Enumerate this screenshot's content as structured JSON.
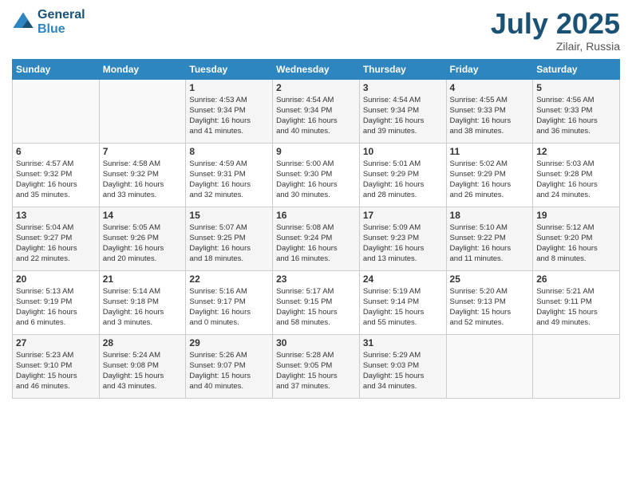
{
  "header": {
    "logo_line1": "General",
    "logo_line2": "Blue",
    "month": "July 2025",
    "location": "Zilair, Russia"
  },
  "weekdays": [
    "Sunday",
    "Monday",
    "Tuesday",
    "Wednesday",
    "Thursday",
    "Friday",
    "Saturday"
  ],
  "weeks": [
    [
      {
        "day": "",
        "info": ""
      },
      {
        "day": "",
        "info": ""
      },
      {
        "day": "1",
        "info": "Sunrise: 4:53 AM\nSunset: 9:34 PM\nDaylight: 16 hours\nand 41 minutes."
      },
      {
        "day": "2",
        "info": "Sunrise: 4:54 AM\nSunset: 9:34 PM\nDaylight: 16 hours\nand 40 minutes."
      },
      {
        "day": "3",
        "info": "Sunrise: 4:54 AM\nSunset: 9:34 PM\nDaylight: 16 hours\nand 39 minutes."
      },
      {
        "day": "4",
        "info": "Sunrise: 4:55 AM\nSunset: 9:33 PM\nDaylight: 16 hours\nand 38 minutes."
      },
      {
        "day": "5",
        "info": "Sunrise: 4:56 AM\nSunset: 9:33 PM\nDaylight: 16 hours\nand 36 minutes."
      }
    ],
    [
      {
        "day": "6",
        "info": "Sunrise: 4:57 AM\nSunset: 9:32 PM\nDaylight: 16 hours\nand 35 minutes."
      },
      {
        "day": "7",
        "info": "Sunrise: 4:58 AM\nSunset: 9:32 PM\nDaylight: 16 hours\nand 33 minutes."
      },
      {
        "day": "8",
        "info": "Sunrise: 4:59 AM\nSunset: 9:31 PM\nDaylight: 16 hours\nand 32 minutes."
      },
      {
        "day": "9",
        "info": "Sunrise: 5:00 AM\nSunset: 9:30 PM\nDaylight: 16 hours\nand 30 minutes."
      },
      {
        "day": "10",
        "info": "Sunrise: 5:01 AM\nSunset: 9:29 PM\nDaylight: 16 hours\nand 28 minutes."
      },
      {
        "day": "11",
        "info": "Sunrise: 5:02 AM\nSunset: 9:29 PM\nDaylight: 16 hours\nand 26 minutes."
      },
      {
        "day": "12",
        "info": "Sunrise: 5:03 AM\nSunset: 9:28 PM\nDaylight: 16 hours\nand 24 minutes."
      }
    ],
    [
      {
        "day": "13",
        "info": "Sunrise: 5:04 AM\nSunset: 9:27 PM\nDaylight: 16 hours\nand 22 minutes."
      },
      {
        "day": "14",
        "info": "Sunrise: 5:05 AM\nSunset: 9:26 PM\nDaylight: 16 hours\nand 20 minutes."
      },
      {
        "day": "15",
        "info": "Sunrise: 5:07 AM\nSunset: 9:25 PM\nDaylight: 16 hours\nand 18 minutes."
      },
      {
        "day": "16",
        "info": "Sunrise: 5:08 AM\nSunset: 9:24 PM\nDaylight: 16 hours\nand 16 minutes."
      },
      {
        "day": "17",
        "info": "Sunrise: 5:09 AM\nSunset: 9:23 PM\nDaylight: 16 hours\nand 13 minutes."
      },
      {
        "day": "18",
        "info": "Sunrise: 5:10 AM\nSunset: 9:22 PM\nDaylight: 16 hours\nand 11 minutes."
      },
      {
        "day": "19",
        "info": "Sunrise: 5:12 AM\nSunset: 9:20 PM\nDaylight: 16 hours\nand 8 minutes."
      }
    ],
    [
      {
        "day": "20",
        "info": "Sunrise: 5:13 AM\nSunset: 9:19 PM\nDaylight: 16 hours\nand 6 minutes."
      },
      {
        "day": "21",
        "info": "Sunrise: 5:14 AM\nSunset: 9:18 PM\nDaylight: 16 hours\nand 3 minutes."
      },
      {
        "day": "22",
        "info": "Sunrise: 5:16 AM\nSunset: 9:17 PM\nDaylight: 16 hours\nand 0 minutes."
      },
      {
        "day": "23",
        "info": "Sunrise: 5:17 AM\nSunset: 9:15 PM\nDaylight: 15 hours\nand 58 minutes."
      },
      {
        "day": "24",
        "info": "Sunrise: 5:19 AM\nSunset: 9:14 PM\nDaylight: 15 hours\nand 55 minutes."
      },
      {
        "day": "25",
        "info": "Sunrise: 5:20 AM\nSunset: 9:13 PM\nDaylight: 15 hours\nand 52 minutes."
      },
      {
        "day": "26",
        "info": "Sunrise: 5:21 AM\nSunset: 9:11 PM\nDaylight: 15 hours\nand 49 minutes."
      }
    ],
    [
      {
        "day": "27",
        "info": "Sunrise: 5:23 AM\nSunset: 9:10 PM\nDaylight: 15 hours\nand 46 minutes."
      },
      {
        "day": "28",
        "info": "Sunrise: 5:24 AM\nSunset: 9:08 PM\nDaylight: 15 hours\nand 43 minutes."
      },
      {
        "day": "29",
        "info": "Sunrise: 5:26 AM\nSunset: 9:07 PM\nDaylight: 15 hours\nand 40 minutes."
      },
      {
        "day": "30",
        "info": "Sunrise: 5:28 AM\nSunset: 9:05 PM\nDaylight: 15 hours\nand 37 minutes."
      },
      {
        "day": "31",
        "info": "Sunrise: 5:29 AM\nSunset: 9:03 PM\nDaylight: 15 hours\nand 34 minutes."
      },
      {
        "day": "",
        "info": ""
      },
      {
        "day": "",
        "info": ""
      }
    ]
  ]
}
